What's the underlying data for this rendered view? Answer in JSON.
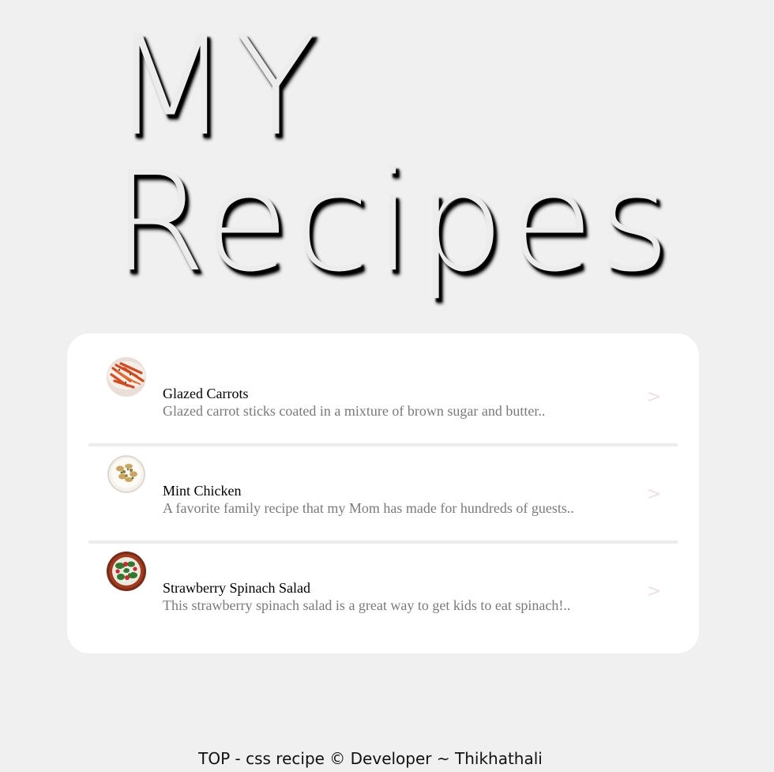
{
  "header": {
    "title_line1": "MY",
    "title_line2": "Recipes"
  },
  "recipes": [
    {
      "name": "Glazed Carrots",
      "description": "Glazed carrot sticks coated in a mixture of brown sugar and butter..",
      "chevron": ">",
      "image_icon": "carrots-photo"
    },
    {
      "name": "Mint Chicken",
      "description": "A favorite family recipe that my Mom has made for hundreds of guests..",
      "chevron": ">",
      "image_icon": "chicken-photo"
    },
    {
      "name": "Strawberry Spinach Salad",
      "description": "This strawberry spinach salad is a great way to get kids to eat spinach!..",
      "chevron": ">",
      "image_icon": "salad-photo"
    }
  ],
  "footer": {
    "text": "TOP - css recipe © Developer ~ Thikhathali"
  },
  "colors": {
    "background": "#f0f0f0",
    "card": "#ffffff",
    "divider": "#ececec",
    "description": "#7a7a7a",
    "chevron": "#f1dede"
  }
}
